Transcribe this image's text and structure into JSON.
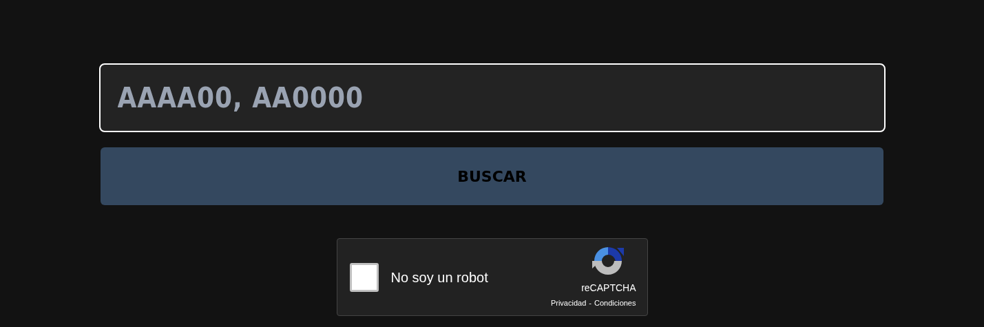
{
  "search": {
    "placeholder": "AAAA00, AA0000"
  },
  "search_button": {
    "label": "BUSCAR"
  },
  "captcha": {
    "label": "No soy un robot",
    "checked": false,
    "brand": "reCAPTCHA",
    "links": [
      "Privacidad",
      "Condiciones"
    ],
    "separator": "-"
  }
}
